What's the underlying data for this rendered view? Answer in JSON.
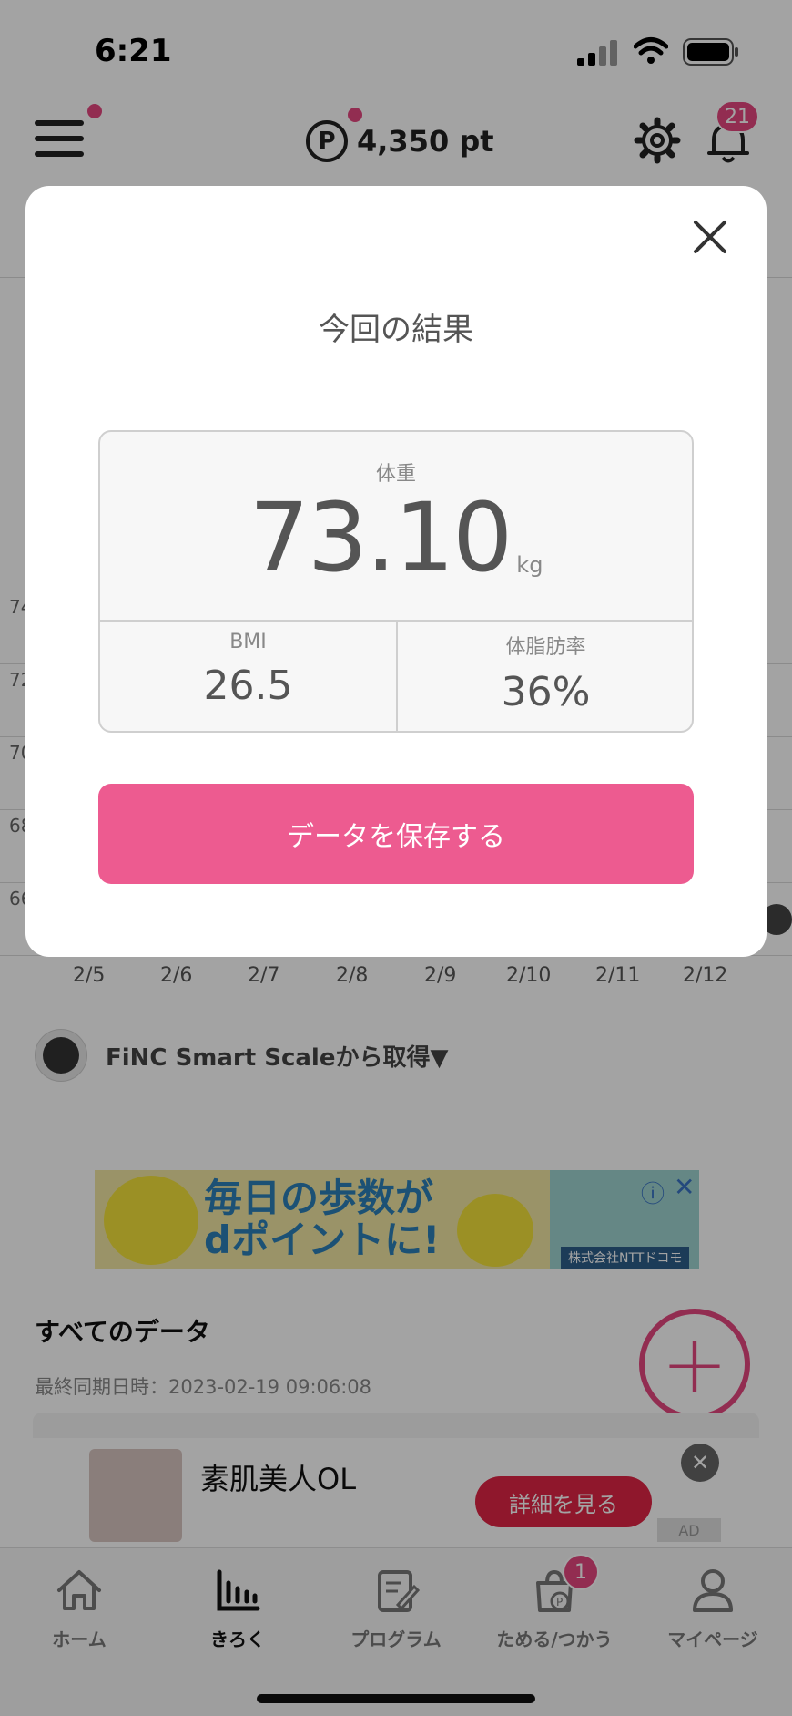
{
  "status_bar": {
    "time": "6:21"
  },
  "header": {
    "points_icon": "P",
    "points": "4,350 pt",
    "notification_count": "21",
    "accent_color": "#e5477f"
  },
  "chart": {
    "y_ticks_partial": [
      "74",
      "72",
      "70",
      "68",
      "66"
    ],
    "x_ticks": [
      "2/5",
      "2/6",
      "2/7",
      "2/8",
      "2/9",
      "2/10",
      "2/11",
      "2/12"
    ]
  },
  "source": {
    "label": "FiNC Smart Scaleから取得▼"
  },
  "ad_banner": {
    "line1": "毎日の歩数が",
    "line2": "dポイントに!",
    "company": "株式会社NTTドコモ",
    "info_icon": "ⓘ",
    "close_icon": "✕"
  },
  "all_data": {
    "title": "すべてのデータ",
    "sync": "最終同期日時：2023-02-19 09:06:08"
  },
  "bottom_ad": {
    "title": "素肌美人OL",
    "cta": "詳細を見る",
    "close": "✕",
    "label": "AD"
  },
  "tab_bar": {
    "items": [
      {
        "label": "ホーム",
        "icon": "home-icon"
      },
      {
        "label": "きろく",
        "icon": "bar-chart-icon"
      },
      {
        "label": "プログラム",
        "icon": "clipboard-icon"
      },
      {
        "label": "ためる/つかう",
        "icon": "shopping-bag-icon",
        "badge": "1"
      },
      {
        "label": "マイページ",
        "icon": "person-icon"
      }
    ]
  },
  "modal": {
    "title": "今回の結果",
    "weight_label": "体重",
    "weight_value": "73.10",
    "weight_unit": "kg",
    "bmi_label": "BMI",
    "bmi_value": "26.5",
    "body_fat_label": "体脂肪率",
    "body_fat_value": "36%",
    "save_button": "データを保存する",
    "button_color": "#ed5b90"
  }
}
